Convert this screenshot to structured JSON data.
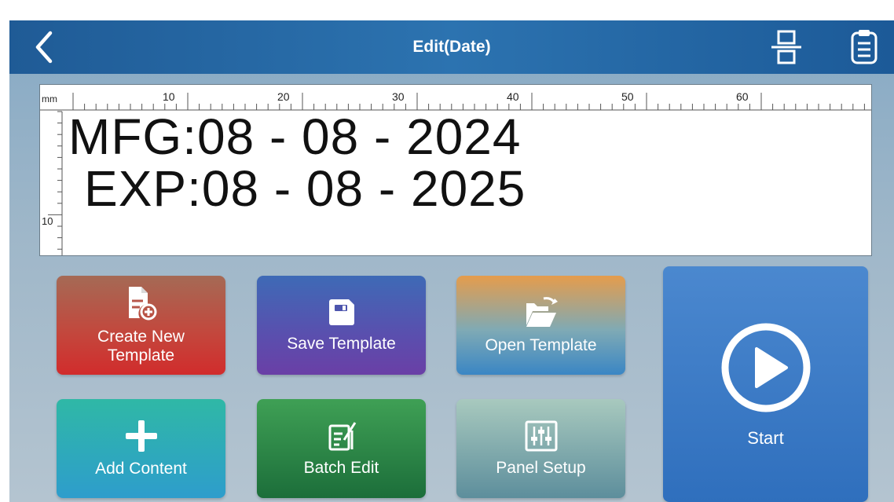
{
  "header": {
    "title": "Edit(Date)",
    "back_icon": "back-chevron-icon",
    "layout_icon": "layout-toggle-icon",
    "list_icon": "clipboard-list-icon"
  },
  "ruler": {
    "unit": "mm",
    "top_labels": [
      "10",
      "20",
      "30",
      "40",
      "50",
      "60"
    ],
    "left_labels": [
      "10"
    ]
  },
  "print_content": {
    "line1": "MFG:08 - 08 - 2024",
    "line2": "EXP:08 - 08 - 2025"
  },
  "actions": {
    "create_new_template": "Create New\nTemplate",
    "save_template": "Save Template",
    "open_template": "Open Template",
    "add_content": "Add Content",
    "batch_edit": "Batch Edit",
    "panel_setup": "Panel Setup",
    "start": "Start"
  },
  "colors": {
    "topbar": "#2c73b0",
    "create": "#d12c2c",
    "save": "#5a4fae",
    "open": "#e59c4c",
    "add": "#2fb8a6",
    "batch": "#1c6e3a",
    "panel": "#5d8e9c",
    "start": "#2f6fbd"
  }
}
